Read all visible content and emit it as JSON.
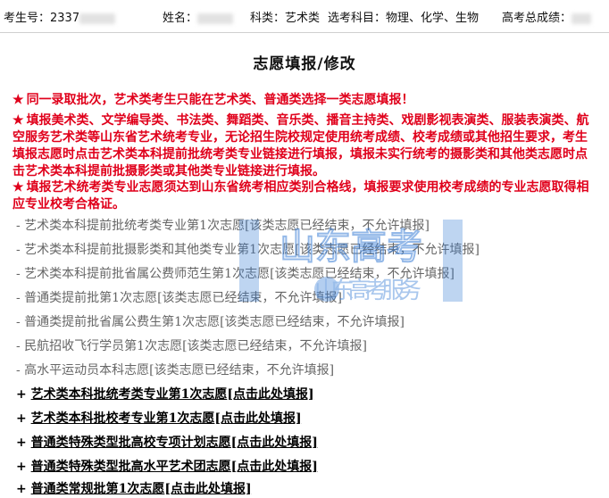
{
  "header": {
    "exam_no_label": "考生号：",
    "exam_no_value": "2337",
    "name_label": "姓名：",
    "subject_label": "科类：",
    "subject_value": "艺术类",
    "elective_label": "选考科目：",
    "elective_value": "物理、化学、生物",
    "score_label": "高考总成绩："
  },
  "title": "志愿填报/修改",
  "notices": [
    "同一录取批次，艺术类考生只能在艺术类、普通类选择一类志愿填报！",
    "填报美术类、文学编导类、书法类、舞蹈类、音乐类、播音主持类、戏剧影视表演类、服装表演类、航空服务艺术类等山东省艺术统考专业，无论招生院校规定使用统考成绩、校考成绩或其他招生要求，考生填报志愿时点击艺术类本科提前批统考类专业链接进行填报，填报未实行统考的摄影类和其他类志愿时点击艺术类本科提前批摄影类或其他类专业链接进行填报。",
    "填报艺术统考类专业志愿须达到山东省统考相应类别合格线，填报要求使用校考成绩的专业志愿取得相应专业校考合格证。"
  ],
  "closed_items": [
    "- 艺术类本科提前批统考类专业第1次志愿[该类志愿已经结束，不允许填报]",
    "- 艺术类本科提前批摄影类和其他类专业第1次志愿[该类志愿已经结束，不允许填报]",
    "- 艺术类本科提前批省属公费师范生第1次志愿[该类志愿已经结束，不允许填报]",
    "- 普通类提前批第1次志愿[该类志愿已经结束，不允许填报]",
    "- 普通类提前批省属公费生第1次志愿[该类志愿已经结束，不允许填报]",
    "- 民航招收飞行学员第1次志愿[该类志愿已经结束，不允许填报]",
    "- 高水平运动员本科志愿[该类志愿已经结束，不允许填报]"
  ],
  "open_items": [
    {
      "prefix": "+ ",
      "name": "艺术类本科批统考类专业第1次志愿",
      "link": "[点击此处填报]"
    },
    {
      "prefix": "+ ",
      "name": "艺术类本科批校考专业第1次志愿",
      "link": "[点击此处填报]"
    },
    {
      "prefix": "+ ",
      "name": "普通类特殊类型批高校专项计划志愿",
      "link": "[点击此处填报]"
    },
    {
      "prefix": "+ ",
      "name": "普通类特殊类型批高水平艺术团志愿",
      "link": "[点击此处填报]"
    },
    {
      "prefix": "+ ",
      "name": "普通类常规批第1次志愿",
      "link": "[点击此处填报]"
    }
  ],
  "watermark": {
    "line1": "山东高考",
    "line2": "山东高考服务"
  },
  "colors": {
    "notice_red": "#e0001b",
    "closed_gray": "#666666",
    "watermark_blue": "#3b7fd6"
  },
  "icons": {
    "notice_marker": "star-icon"
  }
}
